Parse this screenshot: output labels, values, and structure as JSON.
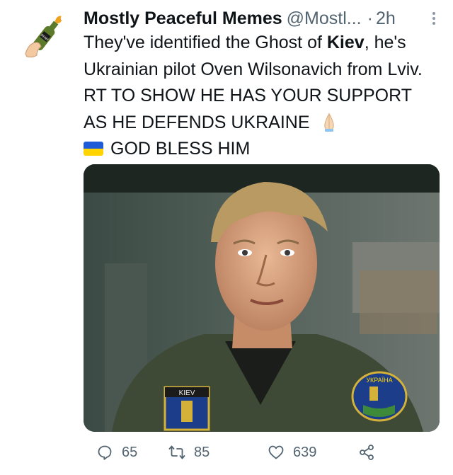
{
  "tweet": {
    "author_name": "Mostly Peaceful Memes",
    "handle": "@Mostl...",
    "separator": "·",
    "time": "2h",
    "text_parts": {
      "p1": "They've identified the Ghost of ",
      "p2": "Kiev",
      "p3": ", he's Ukrainian pilot Oven Wilsonavich from Lviv. RT TO SHOW HE HAS YOUR SUPPORT AS HE DEFENDS UKRAINE",
      "p4": "GOD BLESS HIM"
    },
    "media": {
      "patch_left": "KIEV",
      "patch_right": "УКРАЇНА"
    },
    "stats": {
      "replies": "65",
      "retweets": "85",
      "likes": "639"
    },
    "icons": {
      "avatar": "hand-holding-molotov-bottle",
      "pray": "folded-hands-emoji",
      "flag": "ukraine-flag-emoji",
      "reply": "reply-icon",
      "retweet": "retweet-icon",
      "like": "heart-icon",
      "share": "share-icon"
    },
    "colors": {
      "secondary_text": "#536471",
      "flag_blue": "#1f5bd6",
      "flag_yellow": "#ffd400"
    }
  }
}
